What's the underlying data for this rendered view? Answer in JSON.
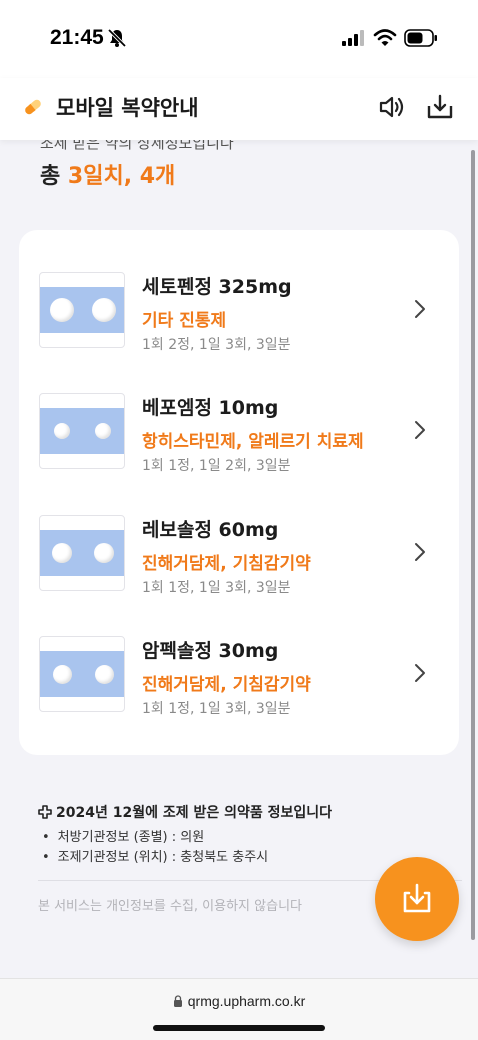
{
  "status_bar": {
    "time": "21:45"
  },
  "header": {
    "title": "모바일 복약안내"
  },
  "summary": {
    "subtitle": "조제 받은 약의 상세정보입니다",
    "total_prefix": "총",
    "total_highlight": "3일치, 4개"
  },
  "medications": [
    {
      "name": "세토펜정 325mg",
      "category": "기타 진통제",
      "dosage": "1회 2정, 1일 3회, 3일분"
    },
    {
      "name": "베포엠정 10mg",
      "category": "항히스타민제, 알레르기 치료제",
      "dosage": "1회 1정, 1일 2회, 3일분"
    },
    {
      "name": "레보솔정 60mg",
      "category": "진해거담제, 기침감기약",
      "dosage": "1회 1정, 1일 3회, 3일분"
    },
    {
      "name": "암펙솔정 30mg",
      "category": "진해거담제, 기침감기약",
      "dosage": "1회 1정, 1일 3회, 3일분"
    }
  ],
  "info": {
    "heading": "2024년 12월에 조제 받은 의약품 정보입니다",
    "lines": [
      "처방기관정보 (종별) : 의원",
      "조제기관정보 (위치) : 충청북도 충주시"
    ],
    "privacy": "본 서비스는 개인정보를 수집, 이용하지 않습니다"
  },
  "browser": {
    "url": "qrmg.upharm.co.kr"
  },
  "colors": {
    "accent": "#f07a1a",
    "fab": "#f7921e",
    "pill_band": "#a9c4ee"
  },
  "icons": [
    "bell-slash-icon",
    "signal-icon",
    "wifi-icon",
    "battery-icon",
    "pill-icon",
    "speaker-icon",
    "download-icon",
    "chevron-right-icon",
    "plus-icon",
    "lock-icon"
  ]
}
